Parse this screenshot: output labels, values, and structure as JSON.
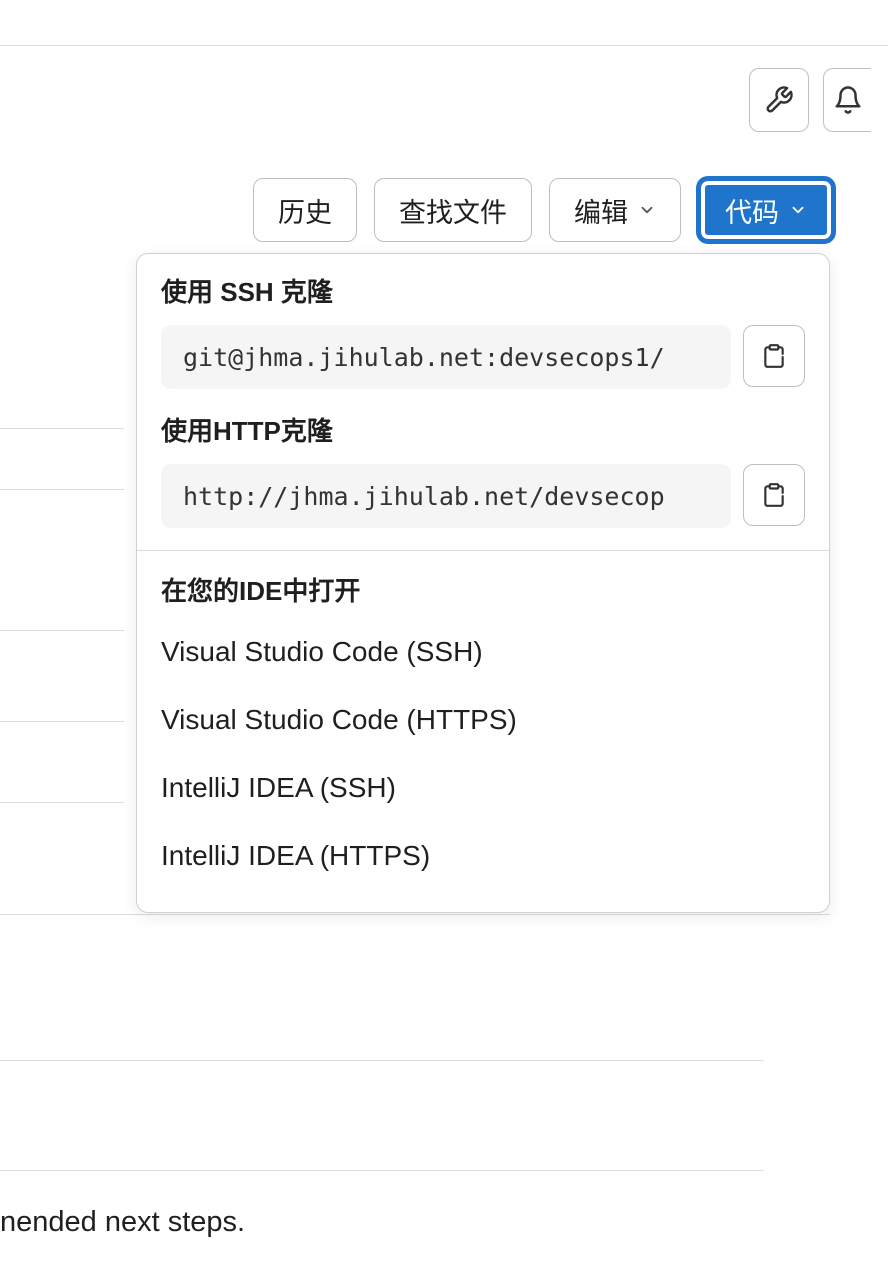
{
  "buttons": {
    "history": "历史",
    "find_file": "查找文件",
    "edit": "编辑",
    "code": "代码"
  },
  "dropdown": {
    "ssh_label": "使用 SSH 克隆",
    "ssh_value": "git@jhma.jihulab.net:devsecops1/",
    "http_label": "使用HTTP克隆",
    "http_value": "http://jhma.jihulab.net/devsecop",
    "ide_label": "在您的IDE中打开",
    "ide_items": [
      "Visual Studio Code (SSH)",
      "Visual Studio Code (HTTPS)",
      "IntelliJ IDEA (SSH)",
      "IntelliJ IDEA (HTTPS)"
    ]
  },
  "footer": {
    "text": "nended next steps."
  }
}
